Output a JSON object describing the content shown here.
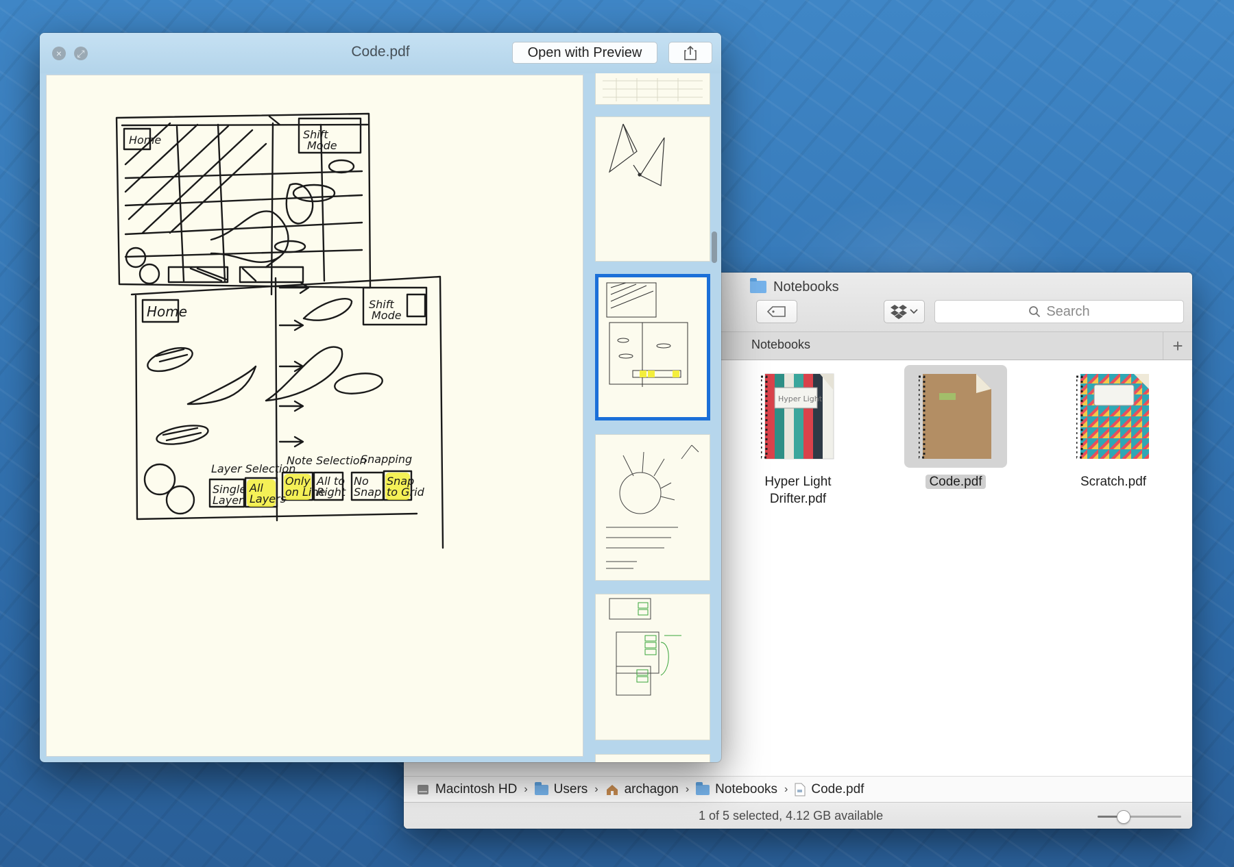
{
  "quicklook": {
    "title": "Code.pdf",
    "open_button": "Open with Preview",
    "share_icon": "share-icon",
    "close_icon": "close-icon",
    "fullscreen_icon": "fullscreen-icon",
    "thumbnails_count": 6,
    "selected_thumbnail": 3
  },
  "finder": {
    "title": "Notebooks",
    "search_placeholder": "Search",
    "tab_label": "Notebooks",
    "add_tab": "+",
    "files": [
      {
        "name_line1": "Hyper Light",
        "name_line2": "Drifter.pdf",
        "selected": false
      },
      {
        "name_line1": "Code.pdf",
        "name_line2": "",
        "selected": true
      },
      {
        "name_line1": "Scratch.pdf",
        "name_line2": "",
        "selected": false
      }
    ],
    "path": [
      "Macintosh HD",
      "Users",
      "archagon",
      "Notebooks",
      "Code.pdf"
    ],
    "status": "1 of 5 selected, 4.12 GB available",
    "icon_size_level": 0.3
  },
  "colors": {
    "selection_blue": "#1b6fd8",
    "highlighter": "#f3ee3c",
    "folder_blue": "#76b3eb"
  }
}
